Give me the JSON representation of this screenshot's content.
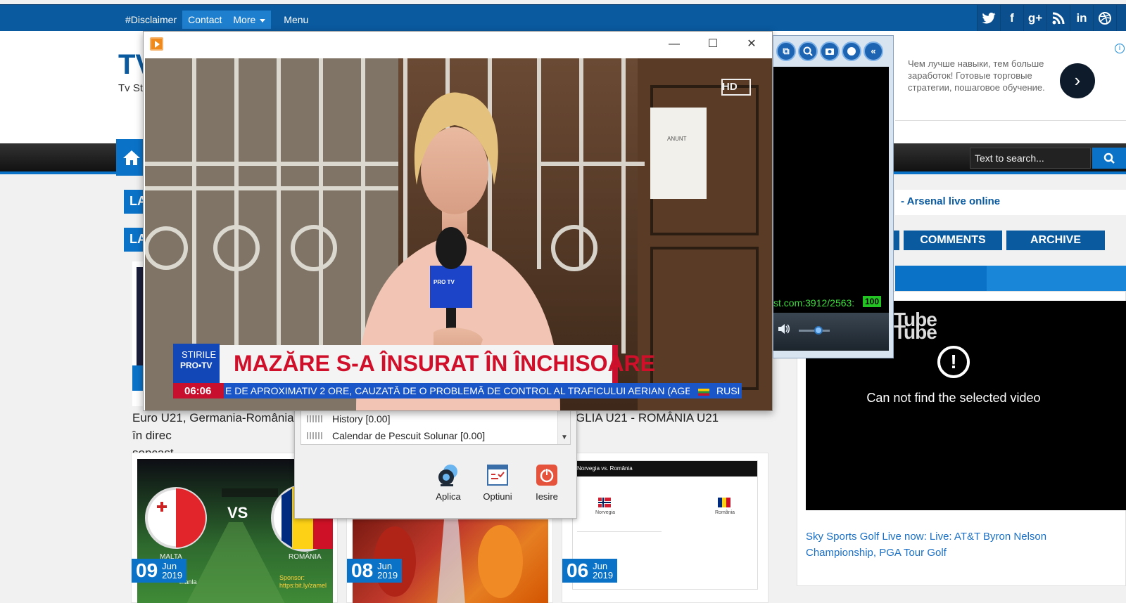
{
  "topnav": {
    "items": [
      "#Disclaimer",
      "Contact",
      "More",
      "Menu"
    ]
  },
  "social": [
    "twitter-icon",
    "facebook-icon",
    "googleplus-icon",
    "rss-icon",
    "linkedin-icon",
    "dribbble-icon",
    "pinterest-icon"
  ],
  "site": {
    "logo": "TV",
    "tagline": "Tv St"
  },
  "ad": {
    "text": "Чем лучше навыки, тем больше заработок! Готовые торговые стратегии, пошаговое обучение.",
    "info": "i"
  },
  "search": {
    "placeholder": "Text to search..."
  },
  "sections": {
    "la1": "LA",
    "la2": "LA"
  },
  "sidebar": {
    "link": "- Arsenal live online",
    "tabs": [
      "COMMENTS",
      "ARCHIVE"
    ],
    "yt_error": "Can not find the selected video",
    "yt_logo": "Tube",
    "golf": "Sky Sports Golf Live now: Live: AT&T Byron Nelson Championship, PGA Tour Golf"
  },
  "posts": {
    "title1_line1": "Euro U21, Germania-România în direc",
    "title1_line2": "sopcast",
    "title3": "GLIA U21 - ROMÂNIA U21",
    "cards": [
      {
        "day": "09",
        "month": "Jun",
        "year": "2019"
      },
      {
        "day": "08",
        "month": "Jun",
        "year": "2019"
      },
      {
        "day": "06",
        "month": "Jun",
        "year": "2019"
      }
    ],
    "thumb1": {
      "team1": "MALTA",
      "vs": "VS",
      "team2": "ROMÂNIA",
      "sub": "manla",
      "sponsor": "Sponsor: https:bit.ly/zamel"
    },
    "thumb3": {
      "title": "Norvegia vs. România",
      "team1": "Norvegia",
      "team2": "România"
    }
  },
  "dialog": {
    "rows": [
      "History [0.00]",
      "Calendar de Pescuit Solunar [0.00]"
    ],
    "buttons": [
      "Aplica",
      "Optiuni",
      "Iesire"
    ]
  },
  "player": {
    "window_controls": [
      "—",
      "☐",
      "✕"
    ],
    "hd": "HD",
    "notice": "ANUNT",
    "mic": "PRO TV",
    "stirile": "STIRILE",
    "protv": "PRO•TV",
    "time": "06:06",
    "headline": "MAZĂRE S-A ÎNSURAT ÎN ÎNCHISOARE",
    "ticker": "E DE APROXIMATIV 2 ORE, CAUZATĂ DE O PROBLEMĂ DE CONTROL AL TRAFICULUI AERIAN (AGERPRES.RO)",
    "ticker_end": "RUSI"
  },
  "mini": {
    "tools": [
      "⧉",
      "🔍",
      "📷",
      "●",
      "«"
    ],
    "url": "st.com:3912/2563:",
    "level": "100"
  }
}
